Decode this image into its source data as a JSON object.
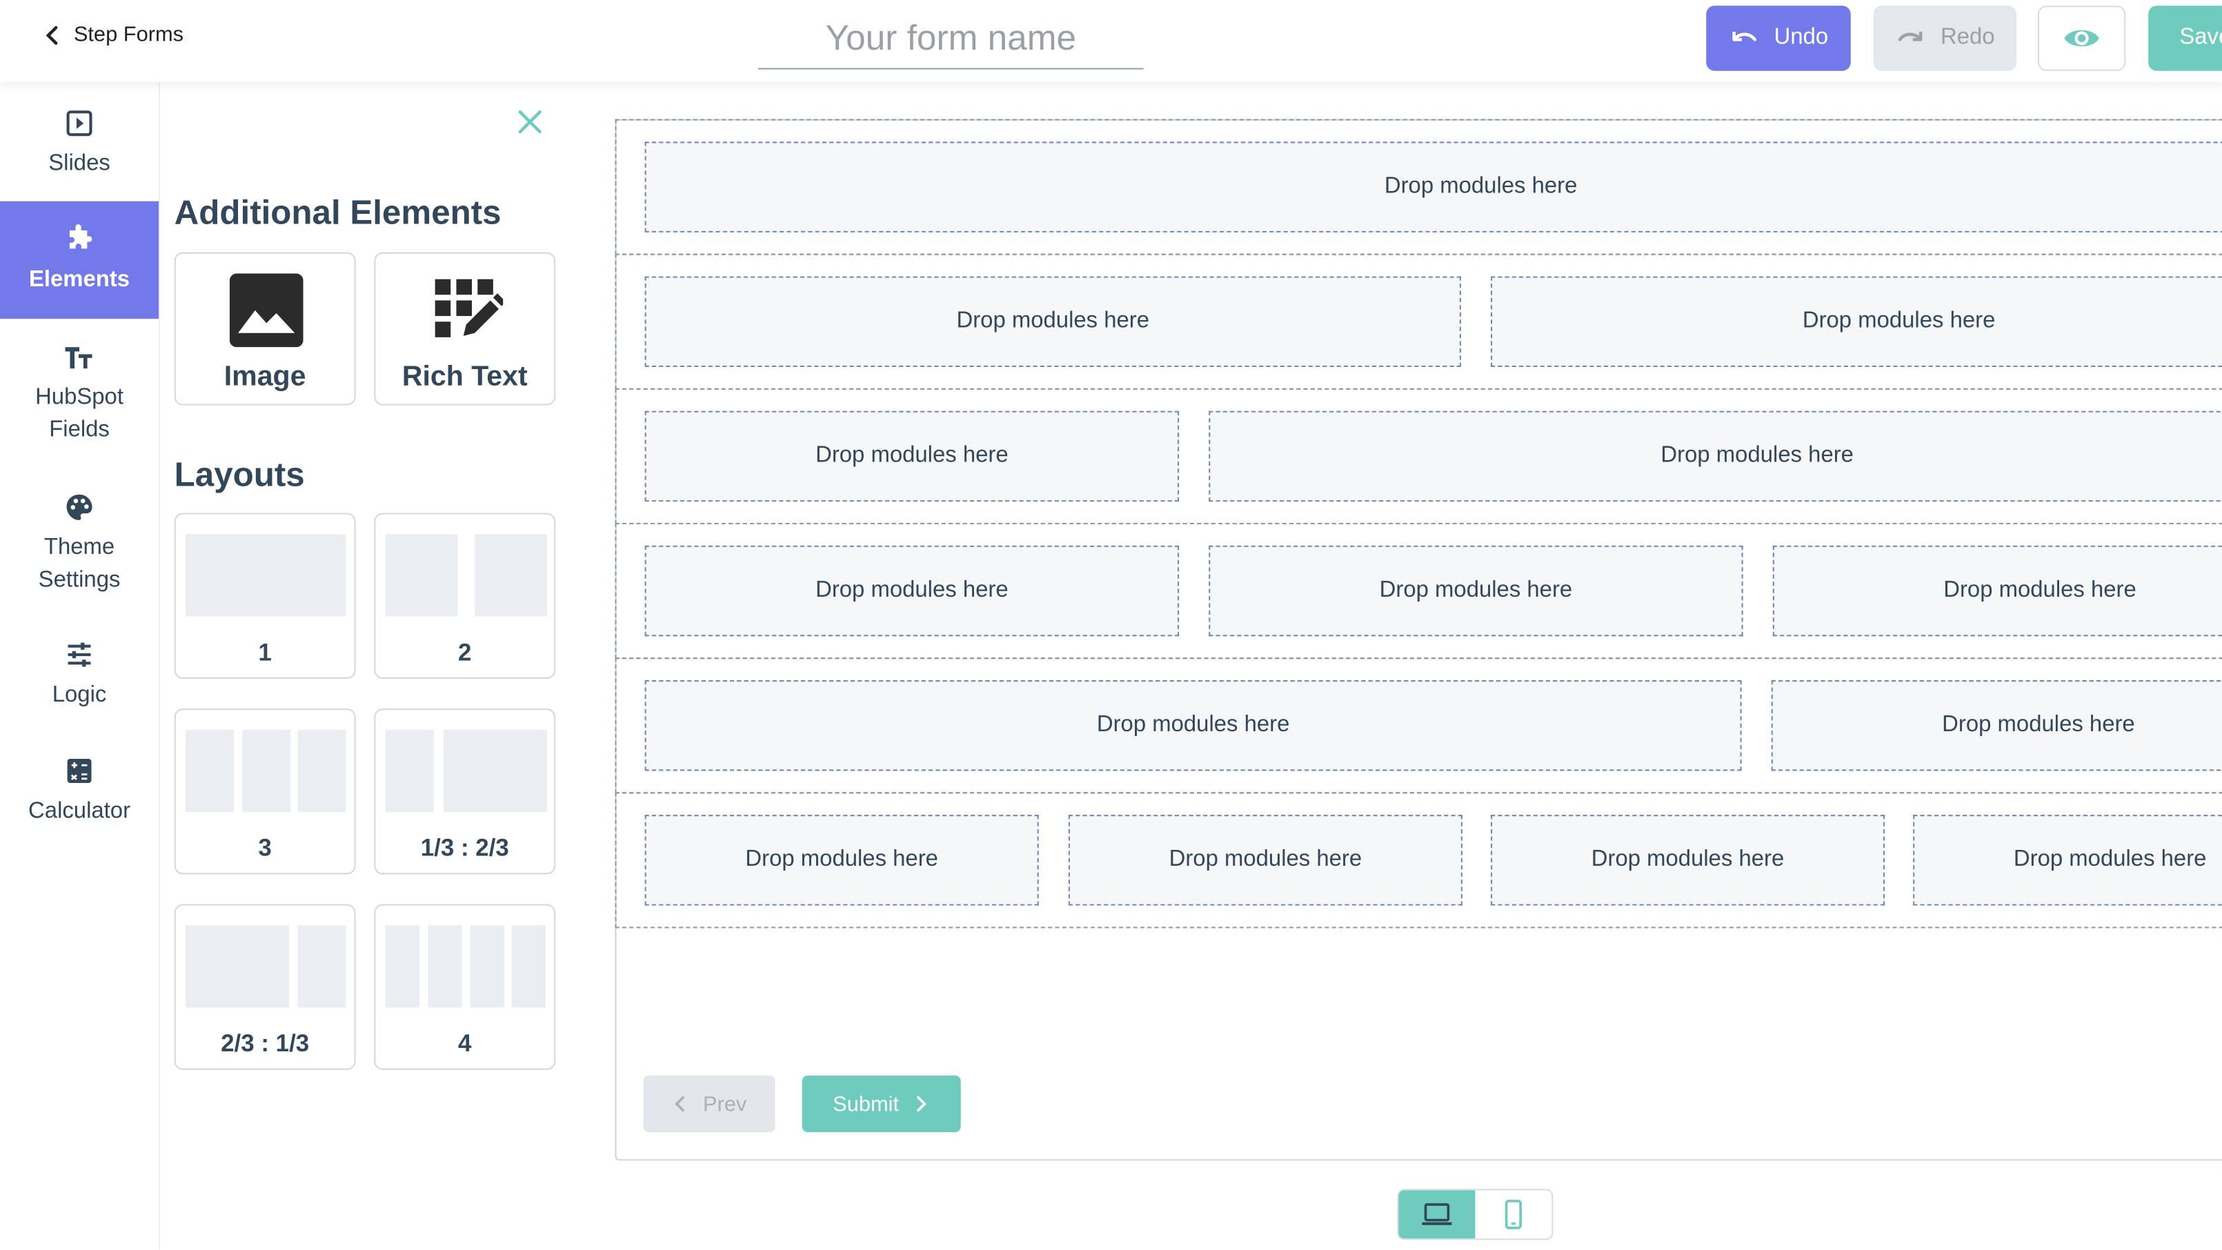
{
  "topbar": {
    "back_label": "Step Forms",
    "form_name_placeholder": "Your form name",
    "form_name_value": "",
    "undo_label": "Undo",
    "redo_label": "Redo",
    "save_label": "Save"
  },
  "leftnav": {
    "items": [
      {
        "label": "Slides",
        "icon": "slides-icon"
      },
      {
        "label": "Elements",
        "icon": "puzzle-icon",
        "active": true
      },
      {
        "label": "HubSpot Fields",
        "icon": "text-format-icon"
      },
      {
        "label": "Theme Settings",
        "icon": "palette-icon"
      },
      {
        "label": "Logic",
        "icon": "sliders-icon"
      },
      {
        "label": "Calculator",
        "icon": "calculator-icon"
      }
    ]
  },
  "panel": {
    "additional_title": "Additional Elements",
    "elements": [
      {
        "label": "Image",
        "icon": "image-icon"
      },
      {
        "label": "Rich Text",
        "icon": "rich-text-icon"
      }
    ],
    "layouts_title": "Layouts",
    "layouts": [
      {
        "label": "1"
      },
      {
        "label": "2"
      },
      {
        "label": "3"
      },
      {
        "label": "1/3 : 2/3"
      },
      {
        "label": "2/3 : 1/3"
      },
      {
        "label": "4"
      }
    ]
  },
  "canvas": {
    "drop_text": "Drop modules here",
    "prev_label": "Prev",
    "submit_label": "Submit"
  },
  "colors": {
    "accent_purple": "#7479ea",
    "accent_teal": "#6fcbbe",
    "text": "#33475b"
  }
}
